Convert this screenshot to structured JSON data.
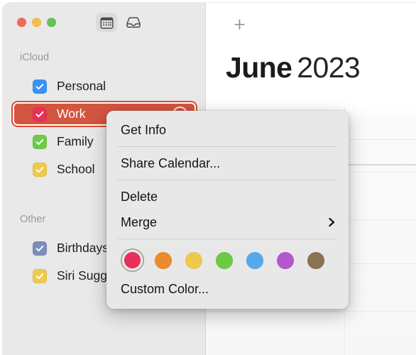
{
  "window": {
    "traffic_lights": [
      {
        "name": "close",
        "color": "#ed6a5e"
      },
      {
        "name": "minimize",
        "color": "#f5bd4f"
      },
      {
        "name": "zoom",
        "color": "#61c454"
      }
    ],
    "toolbar": [
      {
        "icon": "calendar-icon",
        "selected": true
      },
      {
        "icon": "inbox-icon",
        "selected": false
      }
    ]
  },
  "calendar_panel": {
    "add_button_icon": "plus-icon",
    "month": "June",
    "year": "2023"
  },
  "sidebar": {
    "sections": [
      {
        "header": "iCloud",
        "items": [
          {
            "label": "Personal",
            "color": "#3b92f5",
            "checked": true,
            "selected": false
          },
          {
            "label": "Work",
            "color": "#e8305a",
            "checked": true,
            "selected": true
          },
          {
            "label": "Family",
            "color": "#6ccb45",
            "checked": true,
            "selected": false
          },
          {
            "label": "School",
            "color": "#efc94c",
            "checked": true,
            "selected": false
          }
        ]
      },
      {
        "header": "Other",
        "items": [
          {
            "label": "Birthdays",
            "color": "#7b8dba",
            "checked": true,
            "selected": false
          },
          {
            "label": "Siri Suggestions",
            "color": "#efc94c",
            "checked": true,
            "selected": false
          }
        ]
      }
    ]
  },
  "context_menu": {
    "items": [
      {
        "label": "Get Info",
        "submenu": false
      },
      {
        "label": "Share Calendar...",
        "submenu": false
      },
      {
        "label": "Delete",
        "submenu": false
      },
      {
        "label": "Merge",
        "submenu": true
      }
    ],
    "submenu_icon": "chevron-right-icon",
    "colors": [
      {
        "name": "red",
        "hex": "#e8305a",
        "selected": true
      },
      {
        "name": "orange",
        "hex": "#eb8b2d",
        "selected": false
      },
      {
        "name": "yellow",
        "hex": "#efc94c",
        "selected": false
      },
      {
        "name": "green",
        "hex": "#6ccb45",
        "selected": false
      },
      {
        "name": "blue",
        "hex": "#54a9ee",
        "selected": false
      },
      {
        "name": "purple",
        "hex": "#b357cf",
        "selected": false
      },
      {
        "name": "brown",
        "hex": "#8a7350",
        "selected": false
      }
    ],
    "custom_color_label": "Custom Color..."
  }
}
